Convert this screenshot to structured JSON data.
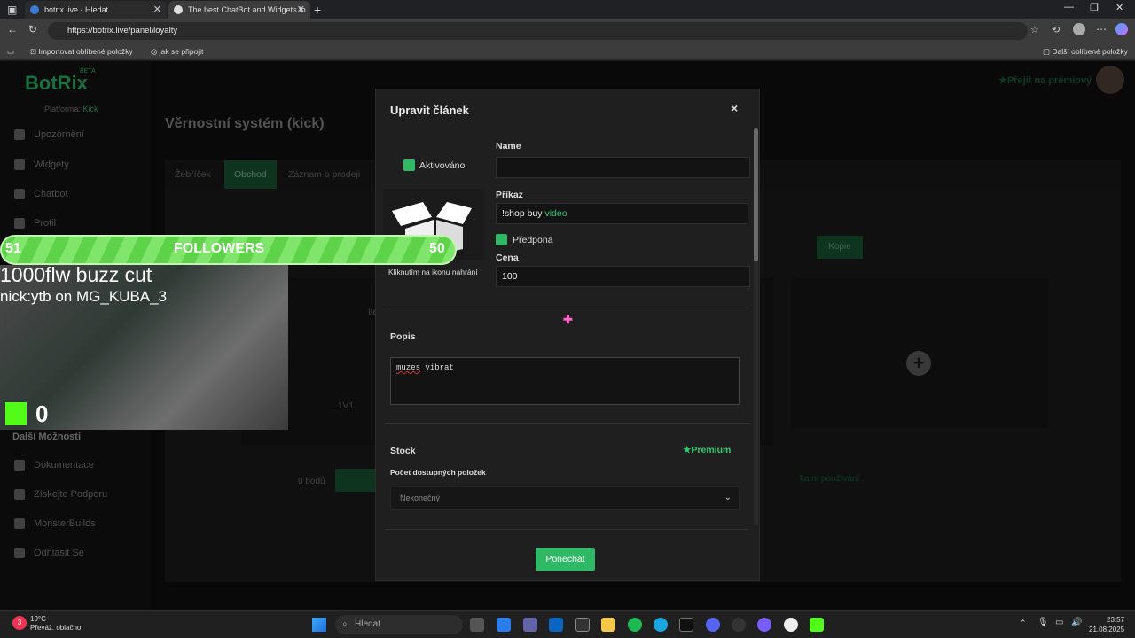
{
  "browser": {
    "tabs": [
      {
        "title": "botrix.live - Hledat"
      },
      {
        "title": "The best ChatBot and Widgets fo"
      }
    ],
    "url": "https://botrix.live/panel/loyalty",
    "bookmarks": {
      "import": "Importovat oblíbené položky",
      "howto": "jak se připojit",
      "other": "Další oblíbené položky"
    }
  },
  "sidebar": {
    "logo": "BotRix",
    "beta": "BETA",
    "platform_label": "Platforma:",
    "platform_value": "Kick",
    "items": [
      {
        "label": "Upozornění"
      },
      {
        "label": "Widgety"
      },
      {
        "label": "Chatbot"
      },
      {
        "label": "Profil"
      }
    ],
    "more_heading": "Další Možnosti",
    "more_items": [
      {
        "label": "Dokumentace"
      },
      {
        "label": "Získejte Podporu"
      },
      {
        "label": "MonsterBuilds"
      },
      {
        "label": "Odhlásit Se"
      }
    ]
  },
  "header": {
    "premium_link": "Přejít na prémiový"
  },
  "main": {
    "title": "Věrnostní systém (kick)",
    "tabs": [
      {
        "label": "Žebříček"
      },
      {
        "label": "Obchod"
      },
      {
        "label": "Záznam o prodeji"
      }
    ],
    "bg_item_col": "Item",
    "bg_item_name": "1V1",
    "bg_points": "0 bodů",
    "bg_copy": "Kopie",
    "bg_footer": "kami používání ."
  },
  "modal": {
    "title": "Upravit článek",
    "close": "×",
    "activated_label": "Aktivováno",
    "name_label": "Name",
    "name_value": "",
    "command_label": "Příkaz",
    "command_prefix": "!shop buy ",
    "command_suffix": "video",
    "prefix_label": "Předpona",
    "price_label": "Cena",
    "price_value": "100",
    "upload_hint": "Kliknutím na ikonu nahrání",
    "description_label": "Popis",
    "description_word1": "muzes",
    "description_word2": " vibrat",
    "stock_label": "Stock",
    "premium_badge": "Premium",
    "available_label": "Počet dostupných položek",
    "available_value": "Nekonečný",
    "keep_button": "Ponechat"
  },
  "overlay": {
    "followers_current": "51",
    "followers_label": "FOLLOWERS",
    "followers_goal": "50",
    "line1": "1000flw buzz cut",
    "line2": "nick:ytb on MG_KUBA_3",
    "kick_count": "0"
  },
  "taskbar": {
    "weather_badge": "3",
    "temperature": "19°C",
    "weather_desc": "Převáž. oblačno",
    "search_placeholder": "Hledat",
    "time": "23:57",
    "date": "21.08.2025"
  },
  "colors": {
    "accent": "#2fb866",
    "kick": "#53fc18"
  }
}
